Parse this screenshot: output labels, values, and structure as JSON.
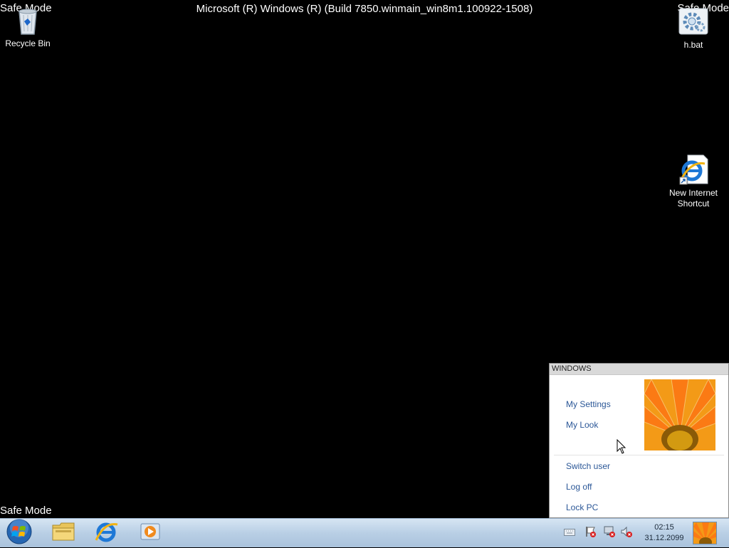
{
  "desktop": {
    "safe_mode_label": "Safe Mode",
    "build_text": "Microsoft (R) Windows (R) (Build 7850.winmain_win8m1.100922-1508)",
    "icons": [
      {
        "label": "Recycle Bin",
        "icon": "recycle-bin-icon"
      },
      {
        "label": "h.bat",
        "icon": "batch-file-gear-icon"
      },
      {
        "label": "New Internet Shortcut",
        "icon": "internet-explorer-icon"
      }
    ]
  },
  "user_panel": {
    "header": "WINDOWS",
    "links_top": [
      "My Settings",
      "My Look"
    ],
    "links_bottom": [
      "Switch user",
      "Log off",
      "Lock PC"
    ],
    "picture": "orange-gerbera-flower-picture"
  },
  "taskbar": {
    "start": "windows-start-orb-icon",
    "pinned": [
      "file-explorer-icon",
      "internet-explorer-icon",
      "media-player-icon"
    ],
    "tray": [
      "keyboard-icon",
      "action-center-flag-icon",
      "network-icon",
      "volume-muted-icon"
    ],
    "clock": {
      "time": "02:15",
      "date": "31.12.2099"
    }
  },
  "colors": {
    "link": "#2b5797",
    "taskbar": "#b9cfe5",
    "desktop": "#000000"
  }
}
